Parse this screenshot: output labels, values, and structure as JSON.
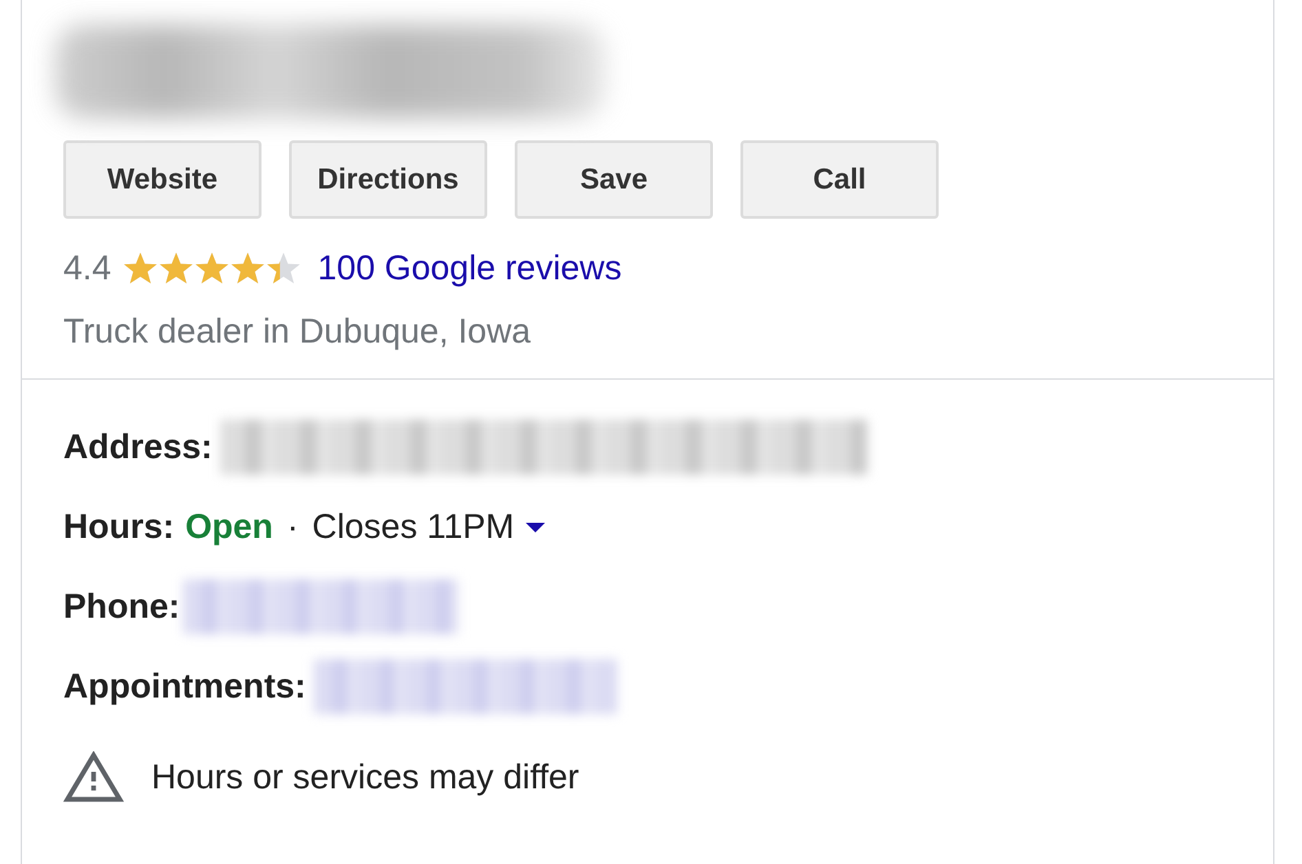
{
  "buttons": [
    {
      "label": "Website"
    },
    {
      "label": "Directions"
    },
    {
      "label": "Save"
    },
    {
      "label": "Call"
    }
  ],
  "rating": {
    "value": "4.4",
    "stars": 4.4,
    "reviews": "100 Google reviews"
  },
  "category": "Truck dealer in Dubuque, Iowa",
  "details": [
    {
      "kind": "blurred",
      "label": "Address:",
      "link": false
    },
    {
      "kind": "hours",
      "label": "Hours:",
      "status": "Open",
      "open": true,
      "separator": "·",
      "closes": "Closes 11PM",
      "expanded": false
    },
    {
      "kind": "blurred",
      "label": "Phone:",
      "link": true
    },
    {
      "kind": "blurred",
      "label": "Appointments:",
      "link": true
    }
  ],
  "notice": "Hours or services may differ"
}
